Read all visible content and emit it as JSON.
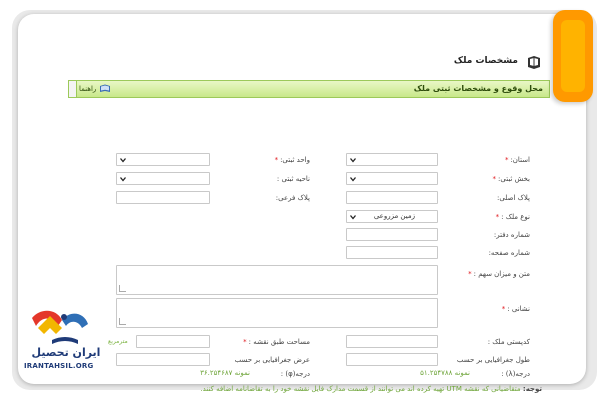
{
  "header": {
    "title": "مشخصات ملک",
    "icon": "book-icon"
  },
  "section": {
    "title": "محل وقوع و مشخصات ثبتی ملک",
    "help_label": "راهنما",
    "help_icon": "book-icon"
  },
  "form": {
    "ostan_label": "استان:",
    "vahed_label": "واحد ثبتی:",
    "bakhsh_label": "بخش ثبتی:",
    "nahie_label": "ناحیه ثبتی :",
    "pelak_asli_label": "پلاک اصلی:",
    "pelak_farei_label": "پلاک فرعی:",
    "noe_melk_label": "نوع ملک :",
    "noe_melk_value": "زمین مزروعی",
    "daftar_label": "شماره دفتر:",
    "safhe_label": "شماره صفحه:",
    "sahm_label": "متن و میزان سهم :",
    "neshani_label": "نشانی :",
    "codeposti_label": "کدپستی ملک :",
    "masahat_label": "مساحت طبق نقشه :",
    "masahat_unit": "مترمربع",
    "tool_label": "طول جغرافیایی بر حسب",
    "arz_label": "عرض جغرافیایی بر حسب",
    "daraje_a_label": "درجه(λ) :",
    "daraje_phi_label": "درجه(φ) :",
    "example_a": "نمونه ۵۱.۲۵۴۷۸۸",
    "example_phi": "نمونه ۳۶.۲۵۴۶۸۷",
    "note_prefix": "توجه:",
    "note_text": "متقاضیانی که نقشه UTM تهیه کرده اند می توانند از قسمت مدارک فایل نقشه خود را به تقاضانامه اضافه کنند."
  },
  "logo": {
    "name": "ایران تحصیل",
    "site": "IRANTAHSIL.ORG"
  },
  "colors": {
    "accent_orange": "#ff9900",
    "section_green": "#c8e88a",
    "required_red": "#e0161b",
    "hint_green": "#6fa53a"
  }
}
